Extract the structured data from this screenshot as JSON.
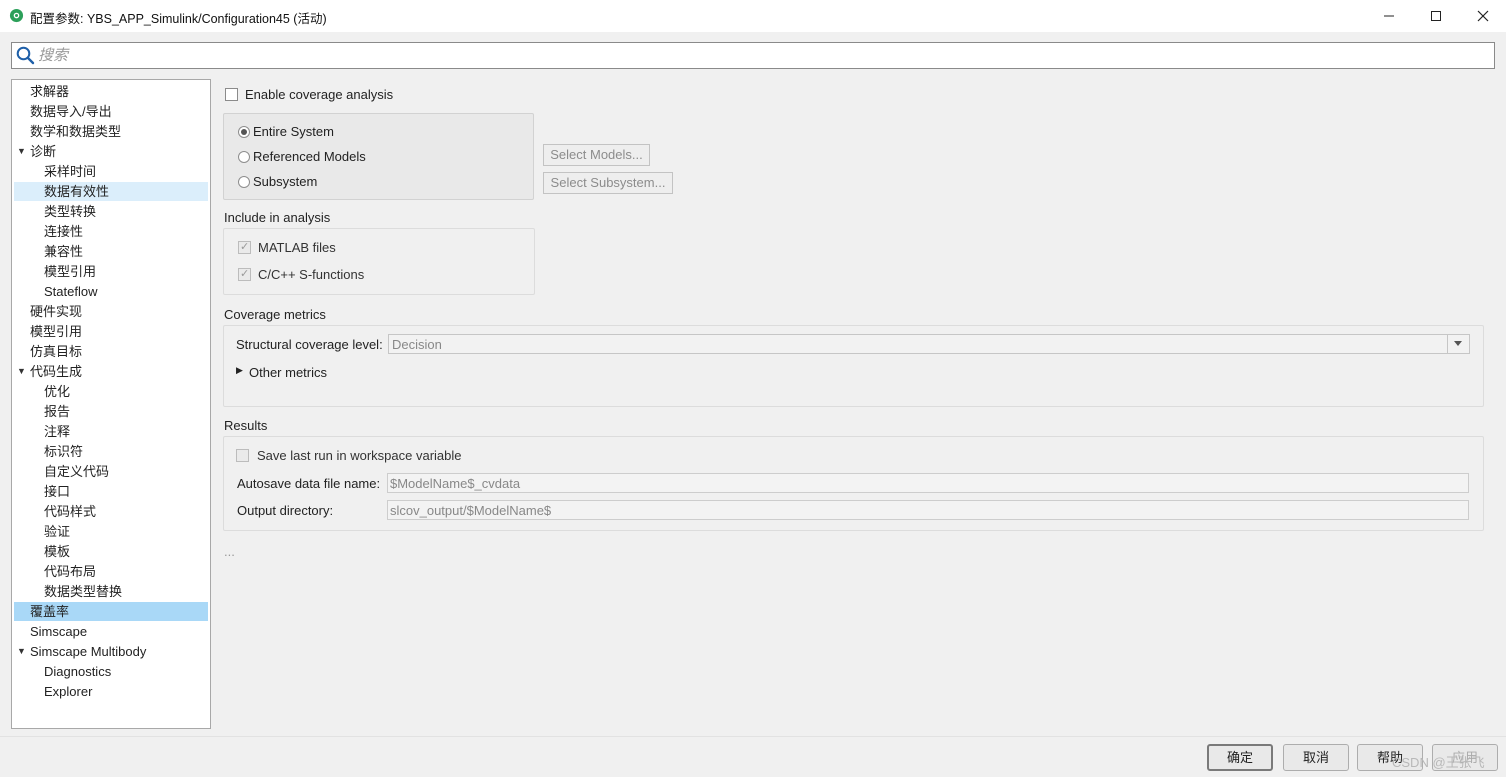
{
  "window": {
    "title": "配置参数: YBS_APP_Simulink/Configuration45 (活动)"
  },
  "search": {
    "placeholder": "搜索",
    "value": ""
  },
  "tree": {
    "items": [
      {
        "label": "求解器"
      },
      {
        "label": "数据导入/导出"
      },
      {
        "label": "数学和数据类型"
      },
      {
        "label": "诊断",
        "expanded": true
      },
      {
        "label": "采样时间"
      },
      {
        "label": "数据有效性"
      },
      {
        "label": "类型转换"
      },
      {
        "label": "连接性"
      },
      {
        "label": "兼容性"
      },
      {
        "label": "模型引用"
      },
      {
        "label": "Stateflow"
      },
      {
        "label": "硬件实现"
      },
      {
        "label": "模型引用"
      },
      {
        "label": "仿真目标"
      },
      {
        "label": "代码生成",
        "expanded": true
      },
      {
        "label": "优化"
      },
      {
        "label": "报告"
      },
      {
        "label": "注释"
      },
      {
        "label": "标识符"
      },
      {
        "label": "自定义代码"
      },
      {
        "label": "接口"
      },
      {
        "label": "代码样式"
      },
      {
        "label": "验证"
      },
      {
        "label": "模板"
      },
      {
        "label": "代码布局"
      },
      {
        "label": "数据类型替换"
      },
      {
        "label": "覆盖率",
        "selected": true
      },
      {
        "label": "Simscape"
      },
      {
        "label": "Simscape Multibody",
        "expanded": true
      },
      {
        "label": "Diagnostics"
      },
      {
        "label": "Explorer"
      }
    ]
  },
  "coverage": {
    "enable_label": "Enable coverage analysis",
    "enable_checked": false,
    "scope": {
      "options": [
        "Entire System",
        "Referenced Models",
        "Subsystem"
      ],
      "selected": "Entire System"
    },
    "select_models_label": "Select Models...",
    "select_subsystem_label": "Select Subsystem...",
    "include_title": "Include in analysis",
    "include": [
      {
        "label": "MATLAB files",
        "checked": true
      },
      {
        "label": "C/C++ S-functions",
        "checked": true
      }
    ],
    "metrics_title": "Coverage metrics",
    "structural_label": "Structural coverage level:",
    "structural_value": "Decision",
    "other_metrics_label": "Other metrics",
    "results_title": "Results",
    "save_last_run_label": "Save last run in workspace variable",
    "save_last_run_checked": false,
    "autosave_label": "Autosave data file name:",
    "autosave_value": "$ModelName$_cvdata",
    "output_dir_label": "Output directory:",
    "output_dir_value": "slcov_output/$ModelName$",
    "ellipsis": "..."
  },
  "footer": {
    "ok_label": "确定",
    "cancel_label": "取消",
    "help_label": "帮助",
    "apply_label": "应用"
  },
  "watermark": "CSDN @王张飞",
  "colors": {
    "selection": "#a9d8f7",
    "selection_light": "#dbeefb",
    "app_icon": "#2ca05a"
  }
}
